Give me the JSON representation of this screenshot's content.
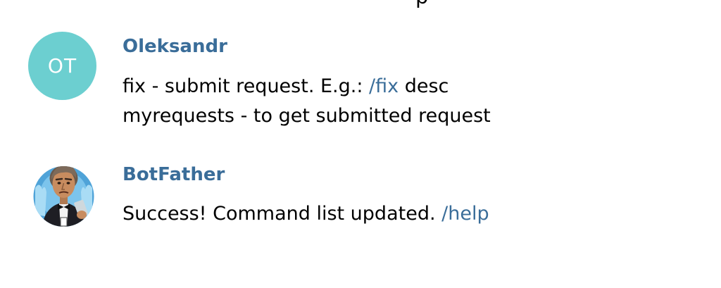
{
  "top_fragment": "p",
  "messages": [
    {
      "sender": "Oleksandr",
      "avatar_initials": "OT",
      "avatar_color": "#6ccfd0",
      "line1_before": "fix - submit request. E.g.: ",
      "line1_link": "/fix",
      "line1_after": " desc",
      "line2": "myrequests - to get submitted request"
    },
    {
      "sender": "BotFather",
      "avatar_icon": "botfather-avatar-icon",
      "text_before": "Success! Command list updated. ",
      "text_link": "/help"
    }
  ],
  "colors": {
    "sender_name": "#3a6d99",
    "link": "#3a6d99",
    "avatar_initials_bg": "#6ccfd0"
  }
}
